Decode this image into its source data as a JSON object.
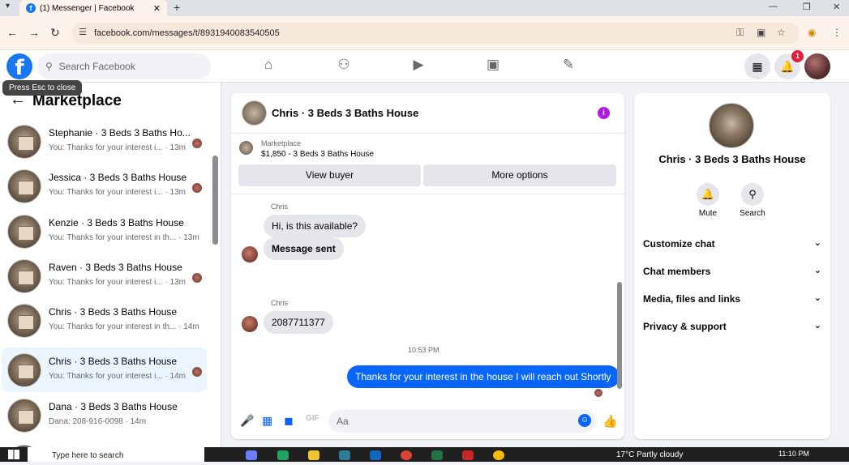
{
  "browser": {
    "tab_title": "(1) Messenger | Facebook",
    "url": "facebook.com/messages/t/8931940083540505"
  },
  "fb_header": {
    "logo": "f",
    "search_placeholder": "Search Facebook",
    "notifications_badge": "1"
  },
  "tooltip": "Press Esc to close",
  "left_panel": {
    "title": "Marketplace",
    "conversations": [
      {
        "name": "Stephanie · 3 Beds 3 Baths Ho...",
        "snippet": "You: Thanks for your interest i... · 13m"
      },
      {
        "name": "Jessica · 3 Beds 3 Baths House",
        "snippet": "You: Thanks for your interest i... · 13m"
      },
      {
        "name": "Kenzie · 3 Beds 3 Baths House",
        "snippet": "You: Thanks for your interest in th... · 13m"
      },
      {
        "name": "Raven · 3 Beds 3 Baths House",
        "snippet": "You: Thanks for your interest i... · 13m"
      },
      {
        "name": "Chris · 3 Beds 3 Baths House",
        "snippet": "You: Thanks for your interest in th... · 14m"
      },
      {
        "name": "Chris · 3 Beds 3 Baths House",
        "snippet": "You: Thanks for your interest i... · 14m"
      },
      {
        "name": "Dana · 3 Beds 3 Baths House",
        "snippet": "Dana: 208-916-0098 · 14m"
      }
    ]
  },
  "chat": {
    "title": "Chris · 3 Beds 3 Baths House",
    "marketplace_label": "Marketplace",
    "listing": "$1,850 - 3 Beds 3 Baths House",
    "view_buyer": "View buyer",
    "more_options": "More options",
    "messages": {
      "sender1": "Chris",
      "m1": "Hi, is this available?",
      "m2": "Message sent",
      "sender2": "Chris",
      "m3": "2087711377",
      "timestamp": "10:53 PM",
      "m4": "Thanks for your interest in the house I will reach out Shortly"
    },
    "input_placeholder": "Aa"
  },
  "right_panel": {
    "name": "Chris · 3 Beds 3 Baths House",
    "mute": "Mute",
    "search": "Search",
    "rows": [
      "Customize chat",
      "Chat members",
      "Media, files and links",
      "Privacy & support"
    ]
  },
  "taskbar": {
    "search_placeholder": "Type here to search",
    "weather": "17°C  Partly cloudy",
    "time": "11:10 PM"
  }
}
